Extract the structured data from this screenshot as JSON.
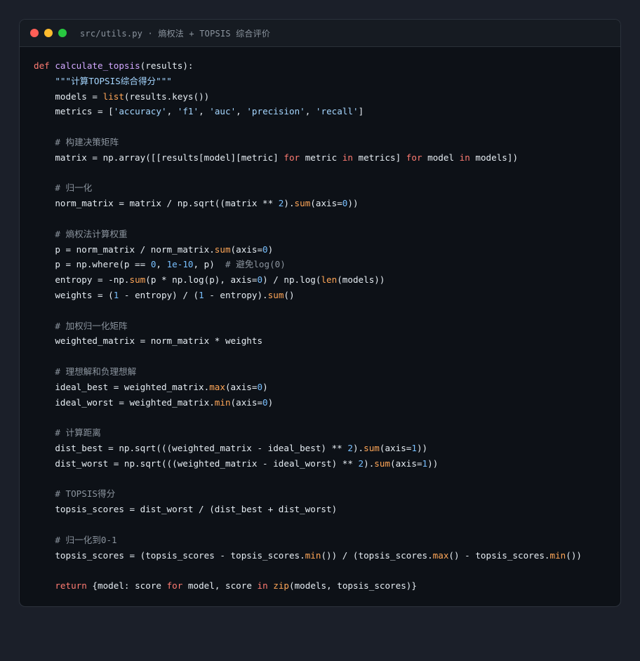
{
  "window": {
    "title": "src/utils.py · 熵权法 + TOPSIS 综合评价"
  },
  "code": {
    "lines": [
      [
        {
          "t": "kw",
          "v": "def "
        },
        {
          "t": "fn",
          "v": "calculate_topsis"
        },
        {
          "t": "plain",
          "v": "(results):"
        }
      ],
      [
        {
          "t": "plain",
          "v": "    "
        },
        {
          "t": "str",
          "v": "\"\"\"计算TOPSIS综合得分\"\"\""
        }
      ],
      [
        {
          "t": "plain",
          "v": "    models = "
        },
        {
          "t": "bi",
          "v": "list"
        },
        {
          "t": "plain",
          "v": "(results.keys())"
        }
      ],
      [
        {
          "t": "plain",
          "v": "    metrics = ["
        },
        {
          "t": "str",
          "v": "'accuracy'"
        },
        {
          "t": "plain",
          "v": ", "
        },
        {
          "t": "str",
          "v": "'f1'"
        },
        {
          "t": "plain",
          "v": ", "
        },
        {
          "t": "str",
          "v": "'auc'"
        },
        {
          "t": "plain",
          "v": ", "
        },
        {
          "t": "str",
          "v": "'precision'"
        },
        {
          "t": "plain",
          "v": ", "
        },
        {
          "t": "str",
          "v": "'recall'"
        },
        {
          "t": "plain",
          "v": "]"
        }
      ],
      [],
      [
        {
          "t": "cm",
          "v": "    # 构建决策矩阵"
        }
      ],
      [
        {
          "t": "plain",
          "v": "    matrix = np.array([[results[model][metric] "
        },
        {
          "t": "kw",
          "v": "for"
        },
        {
          "t": "plain",
          "v": " metric "
        },
        {
          "t": "kw",
          "v": "in"
        },
        {
          "t": "plain",
          "v": " metrics] "
        },
        {
          "t": "kw",
          "v": "for"
        },
        {
          "t": "plain",
          "v": " model "
        },
        {
          "t": "kw",
          "v": "in"
        },
        {
          "t": "plain",
          "v": " models])"
        }
      ],
      [],
      [
        {
          "t": "cm",
          "v": "    # 归一化"
        }
      ],
      [
        {
          "t": "plain",
          "v": "    norm_matrix = matrix / np.sqrt((matrix ** "
        },
        {
          "t": "num",
          "v": "2"
        },
        {
          "t": "plain",
          "v": ")."
        },
        {
          "t": "bi",
          "v": "sum"
        },
        {
          "t": "plain",
          "v": "(axis="
        },
        {
          "t": "num",
          "v": "0"
        },
        {
          "t": "plain",
          "v": "))"
        }
      ],
      [],
      [
        {
          "t": "cm",
          "v": "    # 熵权法计算权重"
        }
      ],
      [
        {
          "t": "plain",
          "v": "    p = norm_matrix / norm_matrix."
        },
        {
          "t": "bi",
          "v": "sum"
        },
        {
          "t": "plain",
          "v": "(axis="
        },
        {
          "t": "num",
          "v": "0"
        },
        {
          "t": "plain",
          "v": ")"
        }
      ],
      [
        {
          "t": "plain",
          "v": "    p = np.where(p == "
        },
        {
          "t": "num",
          "v": "0"
        },
        {
          "t": "plain",
          "v": ", "
        },
        {
          "t": "num",
          "v": "1e-10"
        },
        {
          "t": "plain",
          "v": ", p)  "
        },
        {
          "t": "cm",
          "v": "# 避免log(0)"
        }
      ],
      [
        {
          "t": "plain",
          "v": "    entropy = -np."
        },
        {
          "t": "bi",
          "v": "sum"
        },
        {
          "t": "plain",
          "v": "(p * np.log(p), axis="
        },
        {
          "t": "num",
          "v": "0"
        },
        {
          "t": "plain",
          "v": ") / np.log("
        },
        {
          "t": "bi",
          "v": "len"
        },
        {
          "t": "plain",
          "v": "(models))"
        }
      ],
      [
        {
          "t": "plain",
          "v": "    weights = ("
        },
        {
          "t": "num",
          "v": "1"
        },
        {
          "t": "plain",
          "v": " - entropy) / ("
        },
        {
          "t": "num",
          "v": "1"
        },
        {
          "t": "plain",
          "v": " - entropy)."
        },
        {
          "t": "bi",
          "v": "sum"
        },
        {
          "t": "plain",
          "v": "()"
        }
      ],
      [],
      [
        {
          "t": "cm",
          "v": "    # 加权归一化矩阵"
        }
      ],
      [
        {
          "t": "plain",
          "v": "    weighted_matrix = norm_matrix * weights"
        }
      ],
      [],
      [
        {
          "t": "cm",
          "v": "    # 理想解和负理想解"
        }
      ],
      [
        {
          "t": "plain",
          "v": "    ideal_best = weighted_matrix."
        },
        {
          "t": "bi",
          "v": "max"
        },
        {
          "t": "plain",
          "v": "(axis="
        },
        {
          "t": "num",
          "v": "0"
        },
        {
          "t": "plain",
          "v": ")"
        }
      ],
      [
        {
          "t": "plain",
          "v": "    ideal_worst = weighted_matrix."
        },
        {
          "t": "bi",
          "v": "min"
        },
        {
          "t": "plain",
          "v": "(axis="
        },
        {
          "t": "num",
          "v": "0"
        },
        {
          "t": "plain",
          "v": ")"
        }
      ],
      [],
      [
        {
          "t": "cm",
          "v": "    # 计算距离"
        }
      ],
      [
        {
          "t": "plain",
          "v": "    dist_best = np.sqrt(((weighted_matrix - ideal_best) ** "
        },
        {
          "t": "num",
          "v": "2"
        },
        {
          "t": "plain",
          "v": ")."
        },
        {
          "t": "bi",
          "v": "sum"
        },
        {
          "t": "plain",
          "v": "(axis="
        },
        {
          "t": "num",
          "v": "1"
        },
        {
          "t": "plain",
          "v": "))"
        }
      ],
      [
        {
          "t": "plain",
          "v": "    dist_worst = np.sqrt(((weighted_matrix - ideal_worst) ** "
        },
        {
          "t": "num",
          "v": "2"
        },
        {
          "t": "plain",
          "v": ")."
        },
        {
          "t": "bi",
          "v": "sum"
        },
        {
          "t": "plain",
          "v": "(axis="
        },
        {
          "t": "num",
          "v": "1"
        },
        {
          "t": "plain",
          "v": "))"
        }
      ],
      [],
      [
        {
          "t": "cm",
          "v": "    # TOPSIS得分"
        }
      ],
      [
        {
          "t": "plain",
          "v": "    topsis_scores = dist_worst / (dist_best + dist_worst)"
        }
      ],
      [],
      [
        {
          "t": "cm",
          "v": "    # 归一化到0-1"
        }
      ],
      [
        {
          "t": "plain",
          "v": "    topsis_scores = (topsis_scores - topsis_scores."
        },
        {
          "t": "bi",
          "v": "min"
        },
        {
          "t": "plain",
          "v": "()) / (topsis_scores."
        },
        {
          "t": "bi",
          "v": "max"
        },
        {
          "t": "plain",
          "v": "() - topsis_scores."
        },
        {
          "t": "bi",
          "v": "min"
        },
        {
          "t": "plain",
          "v": "())"
        }
      ],
      [],
      [
        {
          "t": "plain",
          "v": "    "
        },
        {
          "t": "kw",
          "v": "return"
        },
        {
          "t": "plain",
          "v": " {model: score "
        },
        {
          "t": "kw",
          "v": "for"
        },
        {
          "t": "plain",
          "v": " model, score "
        },
        {
          "t": "kw",
          "v": "in"
        },
        {
          "t": "plain",
          "v": " "
        },
        {
          "t": "bi",
          "v": "zip"
        },
        {
          "t": "plain",
          "v": "(models, topsis_scores)}"
        }
      ]
    ]
  }
}
